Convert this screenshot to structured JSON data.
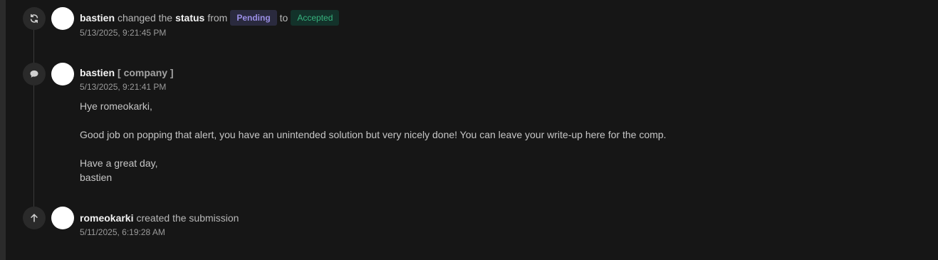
{
  "events": [
    {
      "type": "status-change",
      "icon": "refresh-icon",
      "user": "bastien",
      "text_changed": "changed the",
      "text_status": "status",
      "text_from": "from",
      "from_status": "Pending",
      "text_to": "to",
      "to_status": "Accepted",
      "timestamp": "5/13/2025, 9:21:45 PM"
    },
    {
      "type": "comment",
      "icon": "comment-icon",
      "user": "bastien",
      "role": "[ company ]",
      "timestamp": "5/13/2025, 9:21:41 PM",
      "message": {
        "greeting": "Hye romeokarki,",
        "body": "Good job on popping that alert, you have an unintended solution but very nicely done! You can leave your write-up here for the comp.",
        "closing": "Have a great day,",
        "signature": "bastien"
      }
    },
    {
      "type": "created",
      "icon": "arrow-up-icon",
      "user": "romeokarki",
      "text": "created the submission",
      "timestamp": "5/11/2025, 6:19:28 AM"
    }
  ],
  "colors": {
    "background": "#161616",
    "pending_badge_bg": "#2a2a3e",
    "pending_badge_text": "#9b8fe6",
    "accepted_badge_bg": "#13322a",
    "accepted_badge_text": "#37b37e"
  }
}
